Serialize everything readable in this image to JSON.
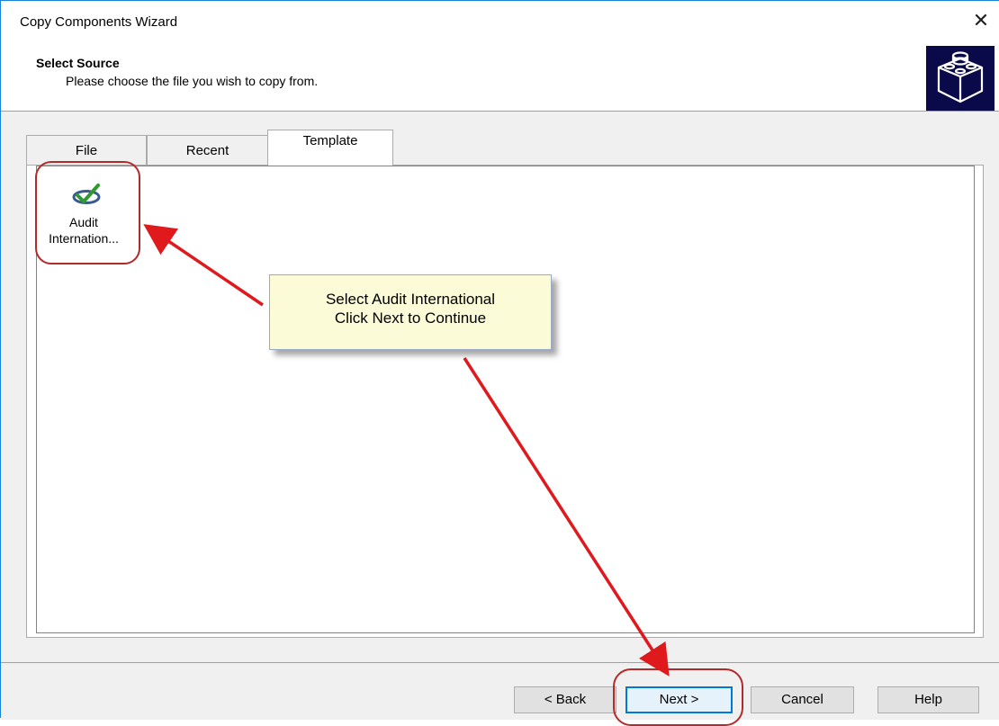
{
  "window": {
    "title": "Copy Components Wizard",
    "close_symbol": "✕"
  },
  "header": {
    "title": "Select Source",
    "subtitle": "Please choose the file you wish to copy from.",
    "logo_icon": "cube-icon"
  },
  "tabs": [
    {
      "label": "File",
      "active": false
    },
    {
      "label": "Recent",
      "active": false
    },
    {
      "label": "Template",
      "active": true
    }
  ],
  "files": [
    {
      "label_line1": "Audit",
      "label_line2": "Internation...",
      "icon": "checkmark-template-icon"
    }
  ],
  "callout": {
    "line1": "Select Audit International",
    "line2": "Click Next to Continue"
  },
  "buttons": {
    "back": "< Back",
    "next": "Next >",
    "cancel": "Cancel",
    "help": "Help"
  },
  "colors": {
    "annotation_red": "#e0191c",
    "highlight_red": "#b22a2a",
    "callout_bg": "#fbfbd8",
    "default_button_border": "#0078d7"
  }
}
